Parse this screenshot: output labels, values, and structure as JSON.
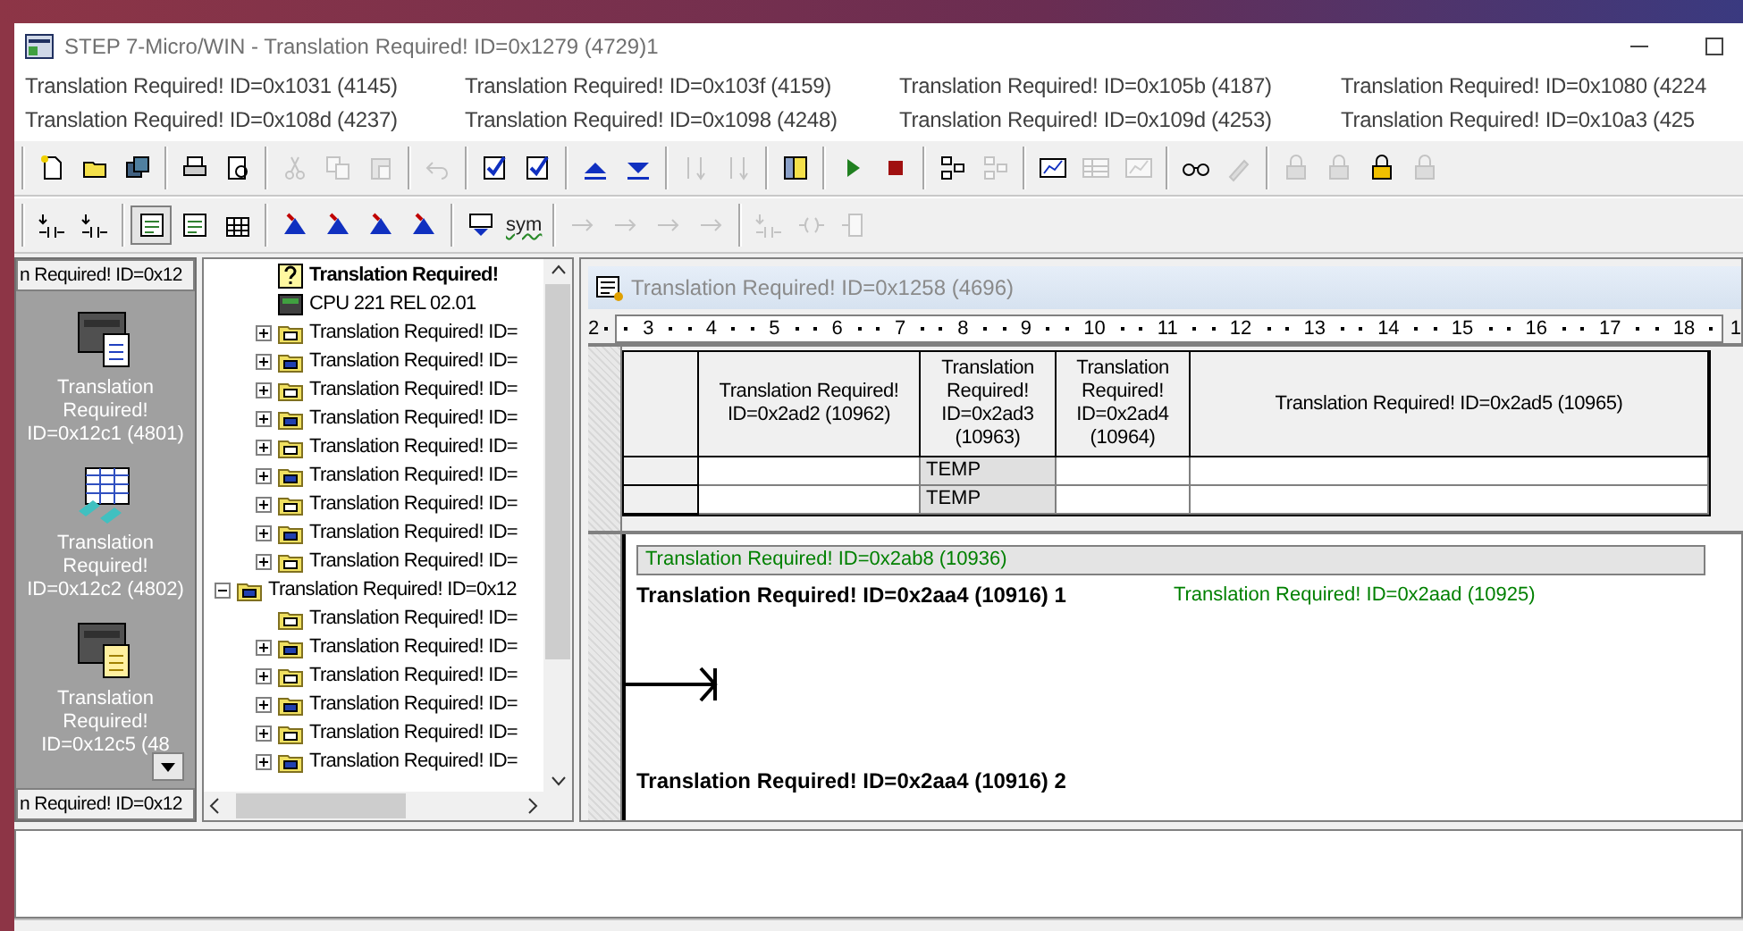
{
  "window": {
    "title": "STEP 7-Micro/WIN - Translation Required! ID=0x1279 (4729)1"
  },
  "menu": [
    {
      "label": "Translation Required! ID=0x1031 (4145)"
    },
    {
      "label": "Translation Required! ID=0x103f (4159)"
    },
    {
      "label": "Translation Required! ID=0x105b (4187)"
    },
    {
      "label": "Translation Required! ID=0x1080 (4224"
    },
    {
      "label": "Translation Required! ID=0x108d (4237)"
    },
    {
      "label": "Translation Required! ID=0x1098 (4248)"
    },
    {
      "label": "Translation Required! ID=0x109d (4253)"
    },
    {
      "label": "Translation Required! ID=0x10a3 (425"
    }
  ],
  "toolbars": [
    {
      "groups": [
        [
          {
            "kind": "new",
            "disabled": false
          },
          {
            "kind": "open",
            "disabled": false
          },
          {
            "kind": "save",
            "disabled": false
          }
        ],
        [
          {
            "kind": "print",
            "disabled": false
          },
          {
            "kind": "preview",
            "disabled": false
          }
        ],
        [
          {
            "kind": "cut",
            "disabled": true
          },
          {
            "kind": "copy",
            "disabled": true
          },
          {
            "kind": "paste",
            "disabled": true
          }
        ],
        [
          {
            "kind": "undo",
            "disabled": true
          }
        ],
        [
          {
            "kind": "check",
            "disabled": false
          },
          {
            "kind": "check",
            "disabled": false
          }
        ],
        [
          {
            "kind": "upload",
            "disabled": false
          },
          {
            "kind": "download",
            "disabled": false
          }
        ],
        [
          {
            "kind": "sort",
            "disabled": true
          },
          {
            "kind": "sort",
            "disabled": true
          }
        ],
        [
          {
            "kind": "window",
            "disabled": false
          }
        ],
        [
          {
            "kind": "run",
            "disabled": false
          },
          {
            "kind": "stop",
            "disabled": false
          }
        ],
        [
          {
            "kind": "blocks",
            "disabled": false
          },
          {
            "kind": "blocks",
            "disabled": true
          }
        ],
        [
          {
            "kind": "chart",
            "disabled": false
          },
          {
            "kind": "table",
            "disabled": true
          },
          {
            "kind": "chart",
            "disabled": true
          }
        ],
        [
          {
            "kind": "glasses",
            "disabled": false
          },
          {
            "kind": "pen",
            "disabled": true
          }
        ],
        [
          {
            "kind": "lock",
            "disabled": true
          },
          {
            "kind": "lock",
            "disabled": true
          },
          {
            "kind": "lock",
            "disabled": false
          },
          {
            "kind": "lock",
            "disabled": true
          }
        ]
      ]
    },
    {
      "groups": [
        [
          {
            "kind": "contact",
            "disabled": false
          },
          {
            "kind": "contact",
            "disabled": false
          }
        ],
        [
          {
            "kind": "view",
            "disabled": false,
            "pressed": true
          },
          {
            "kind": "view",
            "disabled": false,
            "pressed": false
          },
          {
            "kind": "grid",
            "disabled": false,
            "pressed": false
          }
        ],
        [
          {
            "kind": "network",
            "disabled": false
          },
          {
            "kind": "network",
            "disabled": false
          },
          {
            "kind": "network",
            "disabled": false
          },
          {
            "kind": "network",
            "disabled": false
          }
        ],
        [
          {
            "kind": "symbols",
            "disabled": false
          },
          {
            "kind": "text",
            "label": "sym",
            "disabled": false
          }
        ],
        [
          {
            "kind": "arrow",
            "disabled": true
          },
          {
            "kind": "arrow",
            "disabled": true
          },
          {
            "kind": "arrow",
            "disabled": true
          },
          {
            "kind": "arrow",
            "disabled": true
          }
        ],
        [
          {
            "kind": "contact",
            "disabled": true
          },
          {
            "kind": "coil",
            "disabled": true
          },
          {
            "kind": "box",
            "disabled": true
          }
        ]
      ]
    }
  ],
  "navigation_bar": {
    "top_button": "n Required! ID=0x12",
    "items": [
      {
        "label": "Translation Required! ID=0x12c1 (4801)"
      },
      {
        "label": "Translation Required! ID=0x12c2 (4802)"
      },
      {
        "label": "Translation Required! ID=0x12c5 (48"
      }
    ],
    "bottom_button": "n Required! ID=0x12"
  },
  "tree": [
    {
      "children": [
        {
          "label": "Translation Required!",
          "bold": true
        },
        {
          "label": "CPU 221 REL 02.01",
          "bold": false
        },
        {
          "label": "Translation Required! ID=",
          "bold": false,
          "expanded": false
        },
        {
          "label": "Translation Required! ID=",
          "bold": false,
          "expanded": false
        },
        {
          "label": "Translation Required! ID=",
          "bold": false,
          "expanded": false
        },
        {
          "label": "Translation Required! ID=",
          "bold": false,
          "expanded": false
        },
        {
          "label": "Translation Required! ID=",
          "bold": false,
          "expanded": false
        },
        {
          "label": "Translation Required! ID=",
          "bold": false,
          "expanded": false
        },
        {
          "label": "Translation Required! ID=",
          "bold": false,
          "expanded": false
        },
        {
          "label": "Translation Required! ID=",
          "bold": false,
          "expanded": false
        },
        {
          "label": "Translation Required! ID=",
          "bold": false,
          "expanded": false
        }
      ]
    },
    {
      "label": "Translation Required! ID=0x12",
      "bold": false,
      "expanded": true,
      "children": [
        {
          "label": "Translation Required! ID=",
          "bold": false
        },
        {
          "label": "Translation Required! ID=",
          "bold": false,
          "expanded": false
        },
        {
          "label": "Translation Required! ID=",
          "bold": false,
          "expanded": false
        },
        {
          "label": "Translation Required! ID=",
          "bold": false,
          "expanded": false
        },
        {
          "label": "Translation Required! ID=",
          "bold": false,
          "expanded": false
        },
        {
          "label": "Translation Required! ID=",
          "bold": false,
          "expanded": false
        }
      ]
    }
  ],
  "editor": {
    "title": "Translation Required! ID=0x1258 (4696)",
    "ruler": [
      "2",
      "3",
      "4",
      "5",
      "6",
      "7",
      "8",
      "9",
      "10",
      "11",
      "12",
      "13",
      "14",
      "15",
      "16",
      "17",
      "18",
      "1"
    ],
    "table": {
      "columns": [
        "Translation Required! ID=0x2ad2 (10962)",
        "Translation Required! ID=0x2ad3 (10963)",
        "Translation Required! ID=0x2ad4 (10964)",
        "Translation Required! ID=0x2ad5 (10965)"
      ],
      "rows": [
        {
          "column_2": "TEMP"
        },
        {
          "column_2": "TEMP"
        }
      ]
    },
    "comment_bar": "Translation Required! ID=0x2ab8 (10936)",
    "networks": [
      {
        "title": "Translation Required! ID=0x2aa4 (10916) 1",
        "comment": "Translation Required! ID=0x2aad (10925)"
      },
      {
        "title": "Translation Required! ID=0x2aa4 (10916) 2"
      }
    ]
  }
}
